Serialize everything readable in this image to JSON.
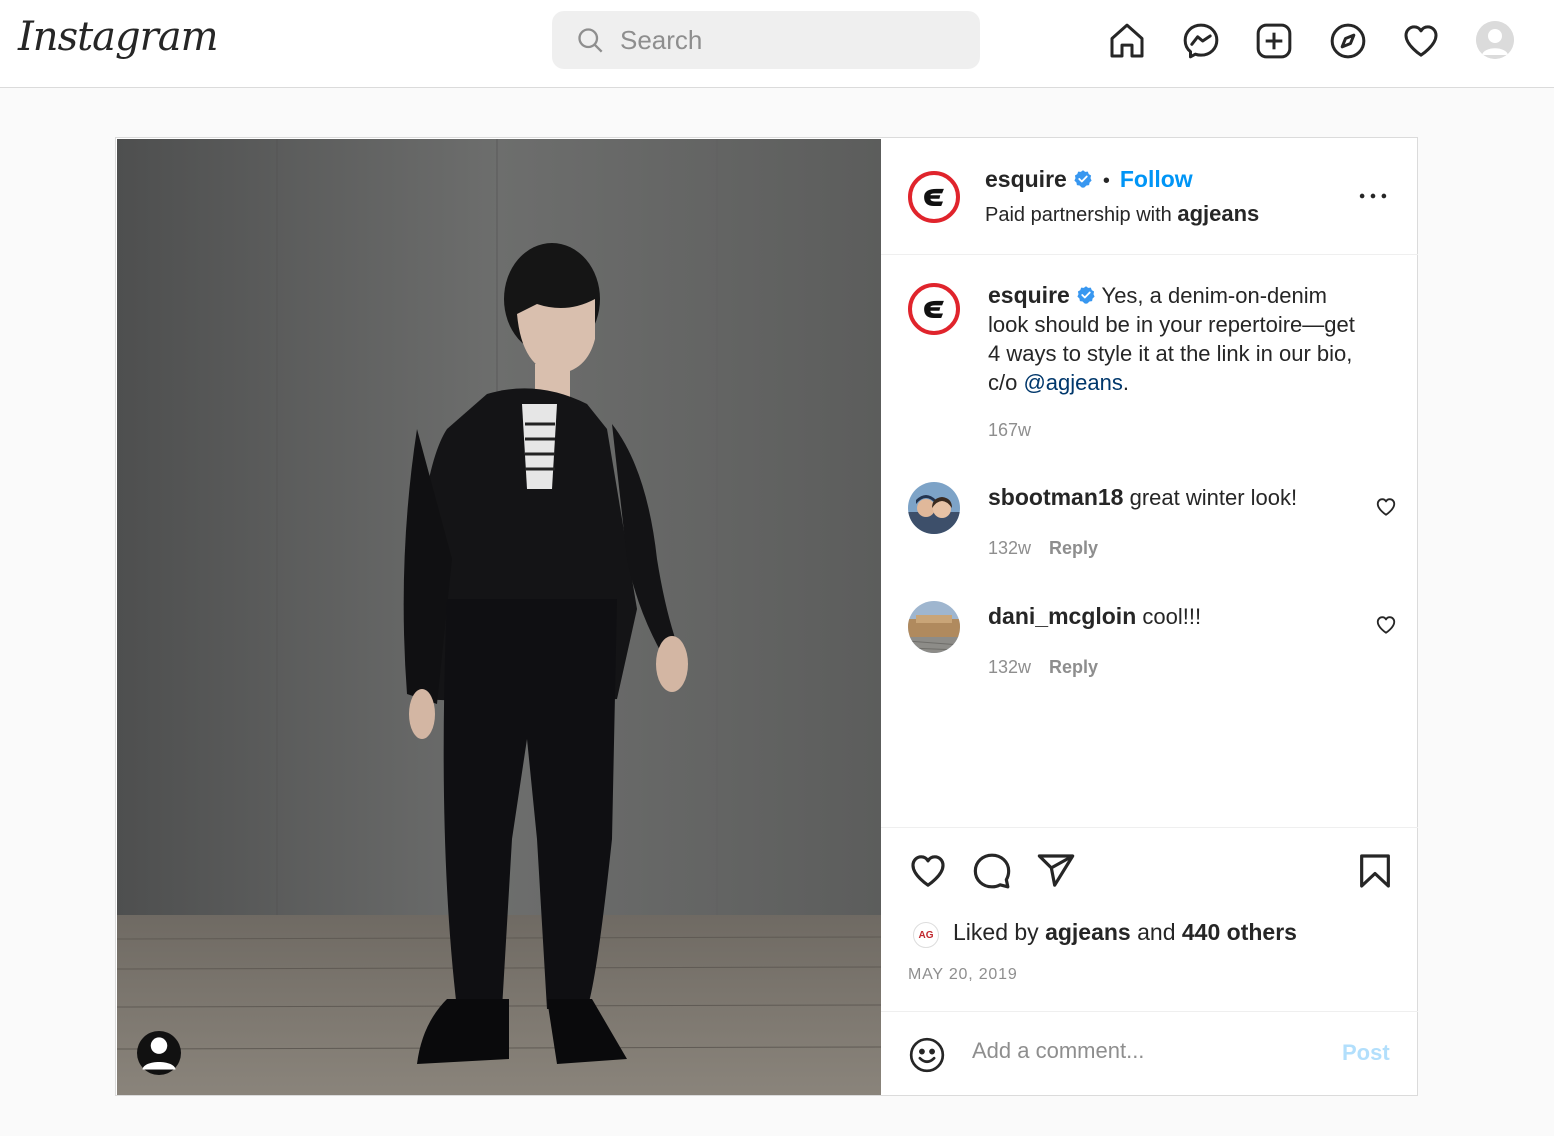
{
  "app": {
    "logo_text": "Instagram"
  },
  "search": {
    "placeholder": "Search"
  },
  "nav": {
    "icons": [
      "home-icon",
      "messenger-icon",
      "new-post-icon",
      "explore-icon",
      "activity-heart-icon",
      "profile-avatar"
    ]
  },
  "post": {
    "author": "esquire",
    "follow_label": "Follow",
    "partnership_prefix": "Paid partnership with",
    "partner": "agjeans",
    "caption_author": "esquire",
    "caption_text": " Yes, a denim-on-denim look should be in your repertoire—get 4 ways to style it at the link in our bio, c/o ",
    "caption_mention": "@agjeans",
    "caption_end": ".",
    "caption_time": "167w",
    "comments": [
      {
        "user": "sbootman18",
        "text": " great winter look!",
        "time": "132w",
        "reply_label": "Reply"
      },
      {
        "user": "dani_mcgloin",
        "text": " cool!!!",
        "time": "132w",
        "reply_label": "Reply"
      }
    ],
    "likes": {
      "prefix": "Liked by ",
      "user": "agjeans",
      "middle": " and ",
      "others": "440 others",
      "logo_text": "AG"
    },
    "date": "MAY 20, 2019",
    "comment_placeholder": "Add a comment...",
    "post_label": "Post"
  },
  "colors": {
    "accent": "#0095f6",
    "esquire_red": "#e0242c",
    "post_disabled": "#b2dffc",
    "mention": "#00376b"
  }
}
